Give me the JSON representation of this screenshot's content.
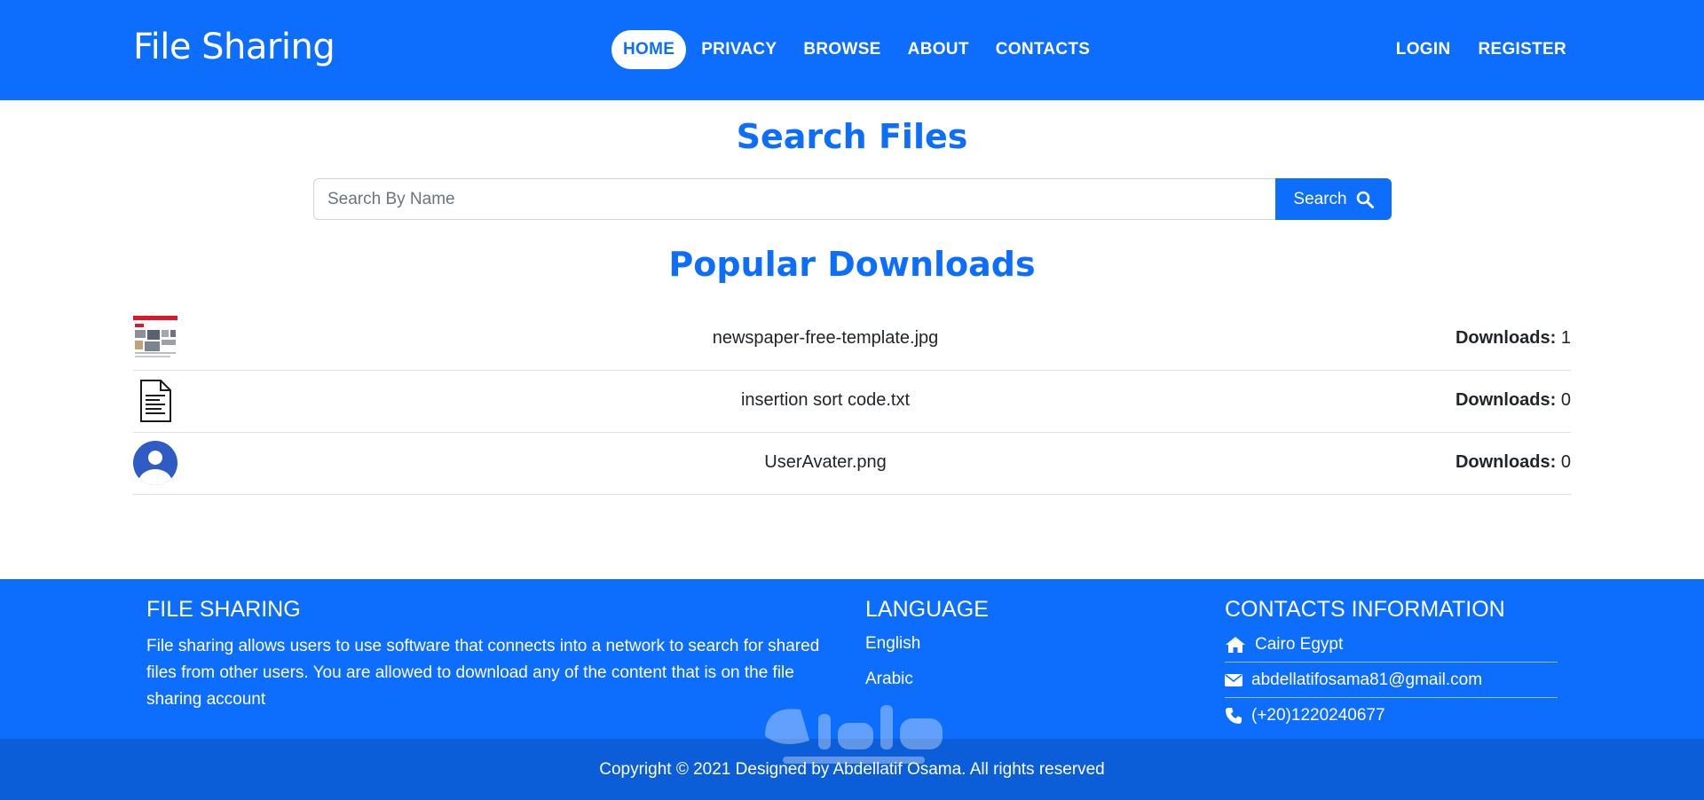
{
  "navbar": {
    "brand": "File Sharing",
    "links": [
      "HOME",
      "PRIVACY",
      "BROWSE",
      "ABOUT",
      "CONTACTS"
    ],
    "active": "HOME",
    "auth": [
      "LOGIN",
      "REGISTER"
    ]
  },
  "search": {
    "title": "Search Files",
    "placeholder": "Search By Name",
    "button_label": "Search"
  },
  "popular": {
    "title": "Popular Downloads",
    "downloads_label": "Downloads:",
    "files": [
      {
        "name": "newspaper-free-template.jpg",
        "downloads": "1",
        "icon": "image-thumbnail"
      },
      {
        "name": "insertion sort code.txt",
        "downloads": "0",
        "icon": "text-file-icon"
      },
      {
        "name": "UserAvater.png",
        "downloads": "0",
        "icon": "user-avatar-icon"
      }
    ]
  },
  "footer": {
    "about_title": "FILE SHARING",
    "about_text": "File sharing allows users to use software that connects into a network to search for shared files from other users. You are allowed to download any of the content that is on the file sharing account",
    "language_title": "LANGUAGE",
    "languages": [
      "English",
      "Arabic"
    ],
    "contacts_title": "CONTACTS INFORMATION",
    "contacts": [
      {
        "icon": "home-icon",
        "text": "Cairo Egypt"
      },
      {
        "icon": "envelope-icon",
        "text": "abdellatifosama81@gmail.com"
      },
      {
        "icon": "phone-icon",
        "text": "(+20)1220240677"
      }
    ]
  },
  "copyright": "Copyright © 2021 Designed by Abdellatif Osama. All rights reserved",
  "colors": {
    "primary": "#0d6efd",
    "footer_bottom": "#0b5ed7"
  }
}
